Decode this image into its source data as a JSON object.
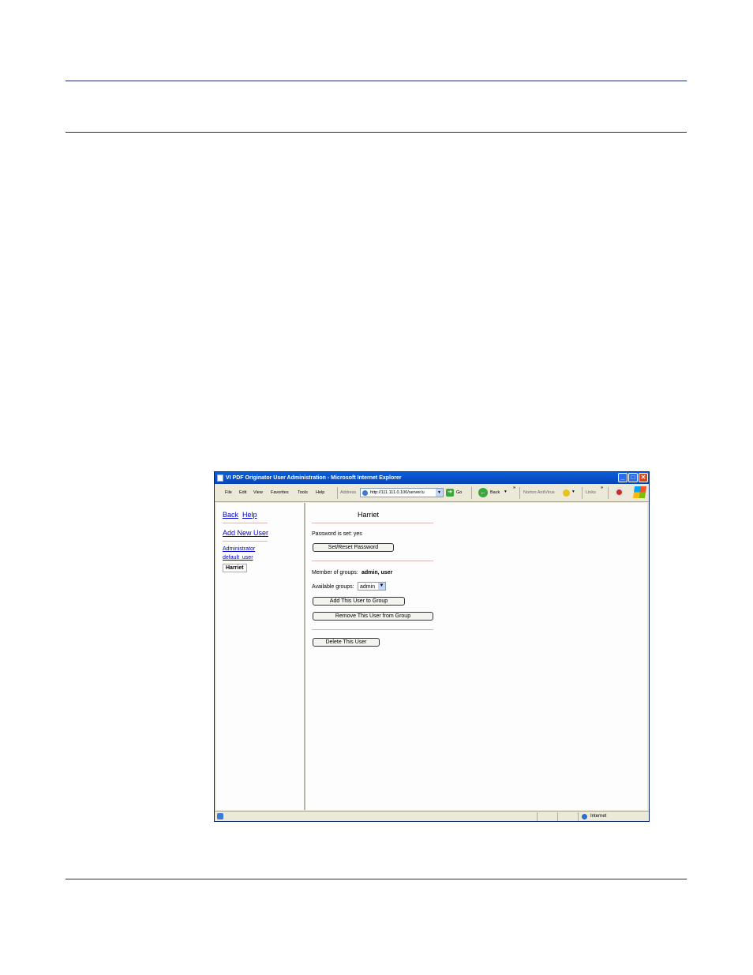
{
  "ie": {
    "window_title": "VI PDF Originator User Administration - Microsoft Internet Explorer",
    "menu": [
      "File",
      "Edit",
      "View",
      "Favorites",
      "Tools",
      "Help"
    ],
    "address_label": "Address",
    "address_value": "http://111.111.0.100/server/u",
    "go_label": "Go",
    "back_label": "Back",
    "norton_label": "Norton AntiVirus",
    "links_label": "Links",
    "status_text": "Internet"
  },
  "left_nav": {
    "back": "Back",
    "help": "Help",
    "add_new_user": "Add New User",
    "users": [
      "Administrator",
      "default_user"
    ],
    "selected_user": "Harriet"
  },
  "main": {
    "username": "Harriet",
    "password_status": "Password is set: yes",
    "set_password_button": "Set/Reset Password",
    "member_label": "Member of groups:",
    "member_groups": "admin, user",
    "available_label": "Available groups:",
    "available_selected": "admin",
    "add_to_group_button": "Add This User to Group",
    "remove_from_group_button": "Remove This User from Group",
    "delete_button": "Delete This User"
  }
}
